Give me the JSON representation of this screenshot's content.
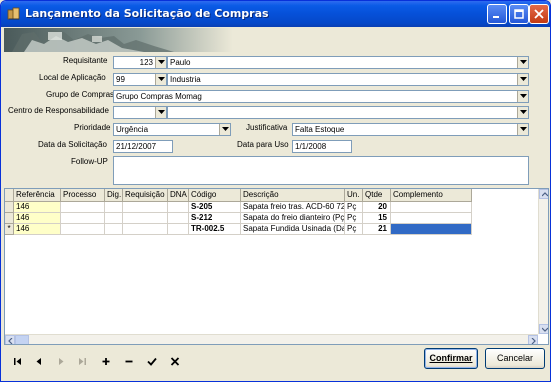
{
  "window": {
    "title": "Lançamento da Solicitação de Compras"
  },
  "form": {
    "requisitante": {
      "label": "Requisitante",
      "code": "123",
      "name": "Paulo"
    },
    "local": {
      "label": "Local de Aplicação",
      "code": "99",
      "name": "Industria"
    },
    "grupo": {
      "label": "Grupo de Compras",
      "value": "Grupo Compras Momag"
    },
    "centro": {
      "label": "Centro de Responsabilidade",
      "code": "",
      "name": ""
    },
    "prioridade": {
      "label": "Prioridade",
      "value": "Urgência"
    },
    "justificativa": {
      "label": "Justificativa",
      "value": "Falta Estoque"
    },
    "data_solicitacao": {
      "label": "Data da Solicitação",
      "value": "21/12/2007"
    },
    "data_uso": {
      "label": "Data para Uso",
      "value": "1/1/2008"
    },
    "followup": {
      "label": "Follow-UP",
      "value": ""
    }
  },
  "grid": {
    "columns": [
      "Referência",
      "Processo",
      "Dig.",
      "Requisição",
      "DNA",
      "Código",
      "Descrição",
      "Un.",
      "Qtde",
      "Complemento"
    ],
    "rows": [
      {
        "indicator": "",
        "referencia": "146",
        "processo": "",
        "dig": "",
        "requisicao": "",
        "dna": "",
        "codigo": "S-205",
        "descricao": "Sapata freio tras. ACD-60 72",
        "un": "Pç",
        "qtde": "20",
        "complemento": ""
      },
      {
        "indicator": "",
        "referencia": "146",
        "processo": "",
        "dig": "",
        "requisicao": "",
        "dna": "",
        "codigo": "S-212",
        "descricao": "Sapata do freio dianteiro (Pç)",
        "un": "Pç",
        "qtde": "15",
        "complemento": ""
      },
      {
        "indicator": "*",
        "referencia": "146",
        "processo": "",
        "dig": "",
        "requisicao": "",
        "dna": "",
        "codigo": "TR-002.5",
        "descricao": "Sapata Fundida Usinada (Da",
        "un": "Pç",
        "qtde": "21",
        "complemento": ""
      }
    ]
  },
  "nav": {
    "icons": [
      "first-record-icon",
      "prior-record-icon",
      "next-record-icon",
      "last-record-icon",
      "insert-record-icon",
      "delete-record-icon",
      "post-record-icon",
      "cancel-edit-icon"
    ]
  },
  "buttons": {
    "confirm_label": "Confirmar",
    "cancel_label": "Cancelar"
  },
  "colors": {
    "titlebar": "#0650d8",
    "selection": "#316ac5",
    "edit_cell": "#ffffc8"
  }
}
